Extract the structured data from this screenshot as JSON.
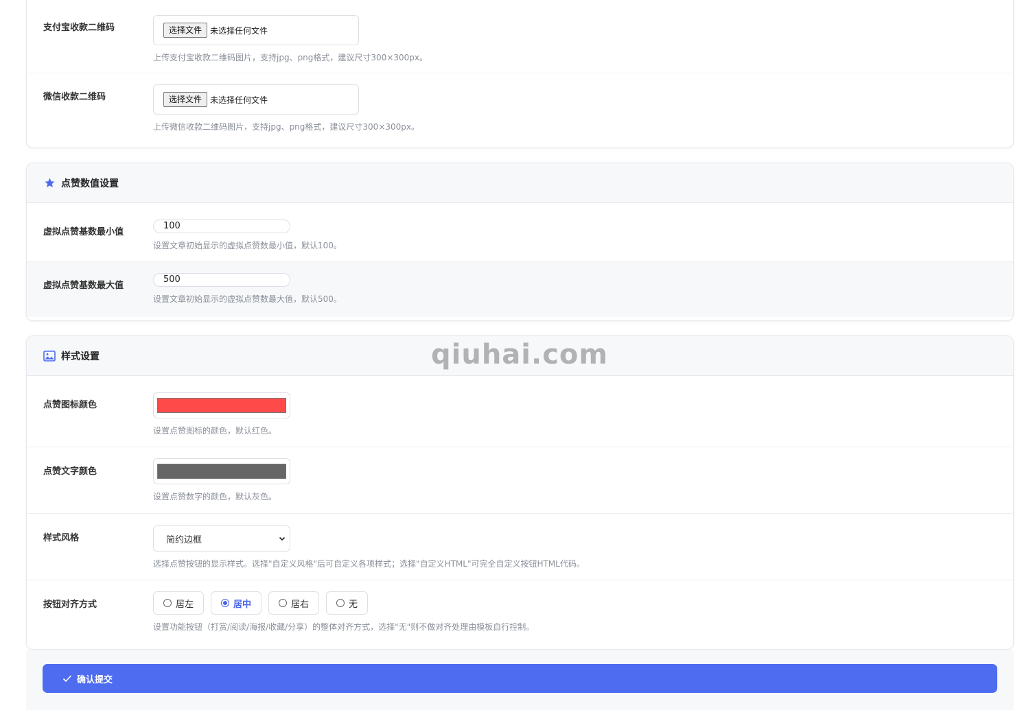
{
  "payment": {
    "alipay": {
      "label": "支付宝收款二维码",
      "file_button": "选择文件",
      "file_status": "未选择任何文件",
      "description": "上传支付宝收款二维码图片，支持jpg、png格式，建议尺寸300×300px。"
    },
    "wechat": {
      "label": "微信收款二维码",
      "file_button": "选择文件",
      "file_status": "未选择任何文件",
      "description": "上传微信收款二维码图片，支持jpg、png格式，建议尺寸300×300px。"
    }
  },
  "likes_section": {
    "title": "点赞数值设置",
    "icon": "star-icon",
    "min": {
      "label": "虚拟点赞基数最小值",
      "value": "100",
      "description": "设置文章初始显示的虚拟点赞数最小值，默认100。"
    },
    "max": {
      "label": "虚拟点赞基数最大值",
      "value": "500",
      "description": "设置文章初始显示的虚拟点赞数最大值，默认500。"
    }
  },
  "style_section": {
    "title": "样式设置",
    "icon": "image-icon",
    "icon_color": {
      "label": "点赞图标颜色",
      "value": "#ff4a4a",
      "description": "设置点赞图标的颜色，默认红色。"
    },
    "text_color": {
      "label": "点赞文字颜色",
      "value": "#666666",
      "description": "设置点赞数字的颜色，默认灰色。"
    },
    "style": {
      "label": "样式风格",
      "selected": "简约边框",
      "description": "选择点赞按钮的显示样式。选择\"自定义风格\"后可自定义各项样式；选择\"自定义HTML\"可完全自定义按钮HTML代码。"
    },
    "align": {
      "label": "按钮对齐方式",
      "options": [
        "居左",
        "居中",
        "居右",
        "无"
      ],
      "selected": "居中",
      "description": "设置功能按钮（打赏/阅读/海报/收藏/分享）的整体对齐方式，选择\"无\"则不做对齐处理由模板自行控制。"
    }
  },
  "submit_label": "确认提交",
  "watermark": "qiuhai.com",
  "colors": {
    "accent": "#4e6cf0",
    "muted_text": "#8a8f99"
  }
}
